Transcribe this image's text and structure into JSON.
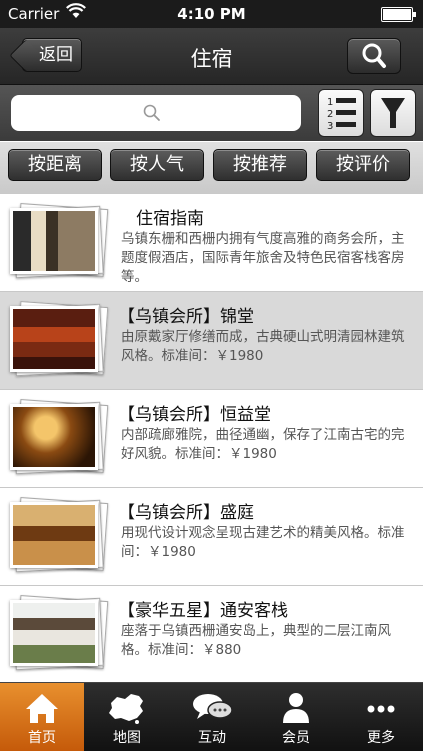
{
  "status_bar": {
    "carrier": "Carrier",
    "time": "4:10 PM"
  },
  "nav": {
    "back_label": "返回",
    "title": "住宿"
  },
  "search": {
    "value": "",
    "placeholder": ""
  },
  "sort_buttons": [
    {
      "label": "按距离"
    },
    {
      "label": "按人气"
    },
    {
      "label": "按推荐"
    },
    {
      "label": "按评价"
    }
  ],
  "list_items": [
    {
      "title": "住宿指南",
      "description": "乌镇东栅和西栅内拥有气度高雅的商务会所，主题度假酒店，国际青年旅舍及特色民宿客栈客房等。",
      "selected": false
    },
    {
      "title": "【乌镇会所】锦堂",
      "description": "由原戴家厅修缮而成，古典硬山式明清园林建筑风格。标准间：￥1980",
      "selected": true
    },
    {
      "title": "【乌镇会所】恒益堂",
      "description": "内部疏廊雅院，曲径通幽，保存了江南古宅的完好风貌。标准间：￥1980",
      "selected": false
    },
    {
      "title": "【乌镇会所】盛庭",
      "description": "用现代设计观念呈现古建艺术的精美风格。标准间：￥1980",
      "selected": false
    },
    {
      "title": "【豪华五星】通安客栈",
      "description": "座落于乌镇西栅通安岛上，典型的二层江南风格。标准间：￥880",
      "selected": false
    }
  ],
  "tabs": [
    {
      "label": "首页",
      "icon": "home-icon",
      "active": true
    },
    {
      "label": "地图",
      "icon": "china-map-icon",
      "active": false
    },
    {
      "label": "互动",
      "icon": "chat-bubbles-icon",
      "active": false
    },
    {
      "label": "会员",
      "icon": "person-icon",
      "active": false
    },
    {
      "label": "更多",
      "icon": "more-dots-icon",
      "active": false
    }
  ],
  "colors": {
    "tab_active": "#d9701a",
    "nav_bg": "#2e2e2e",
    "selected_row": "#d9d9d9"
  }
}
